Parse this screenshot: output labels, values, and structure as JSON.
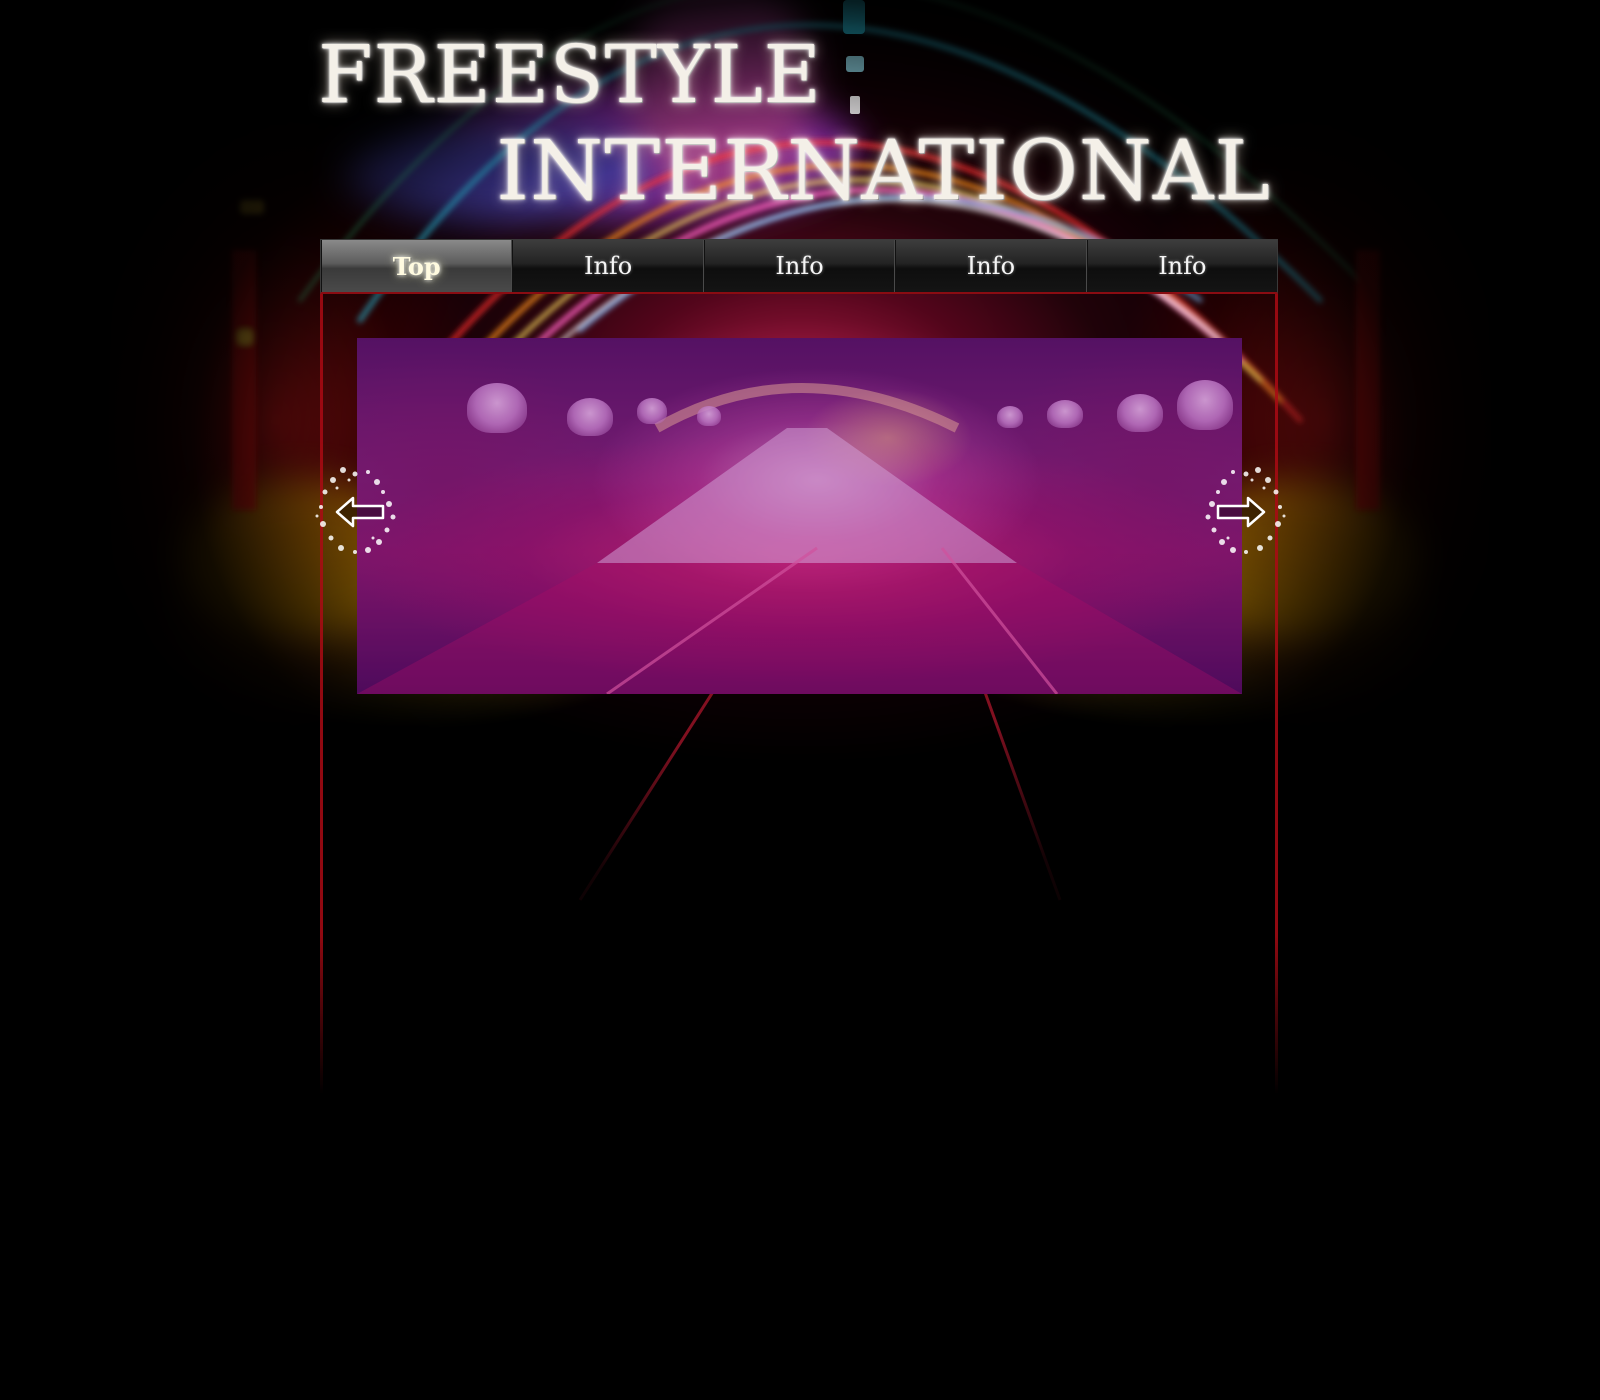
{
  "site": {
    "logo_line1": "FREESTYLE",
    "logo_line2": "INTERNATIONAL"
  },
  "nav": {
    "items": [
      {
        "label": "Top",
        "active": true
      },
      {
        "label": "Info",
        "active": false
      },
      {
        "label": "Info",
        "active": false
      },
      {
        "label": "Info",
        "active": false
      },
      {
        "label": "Info",
        "active": false
      }
    ]
  },
  "slideshow": {
    "prev_icon": "arrow-left-icon",
    "next_icon": "arrow-right-icon"
  },
  "colors": {
    "background": "#000000",
    "frame_accent": "#aa0a14",
    "slide_tint": "#6e0082",
    "logo_text": "#f4f0e8"
  }
}
